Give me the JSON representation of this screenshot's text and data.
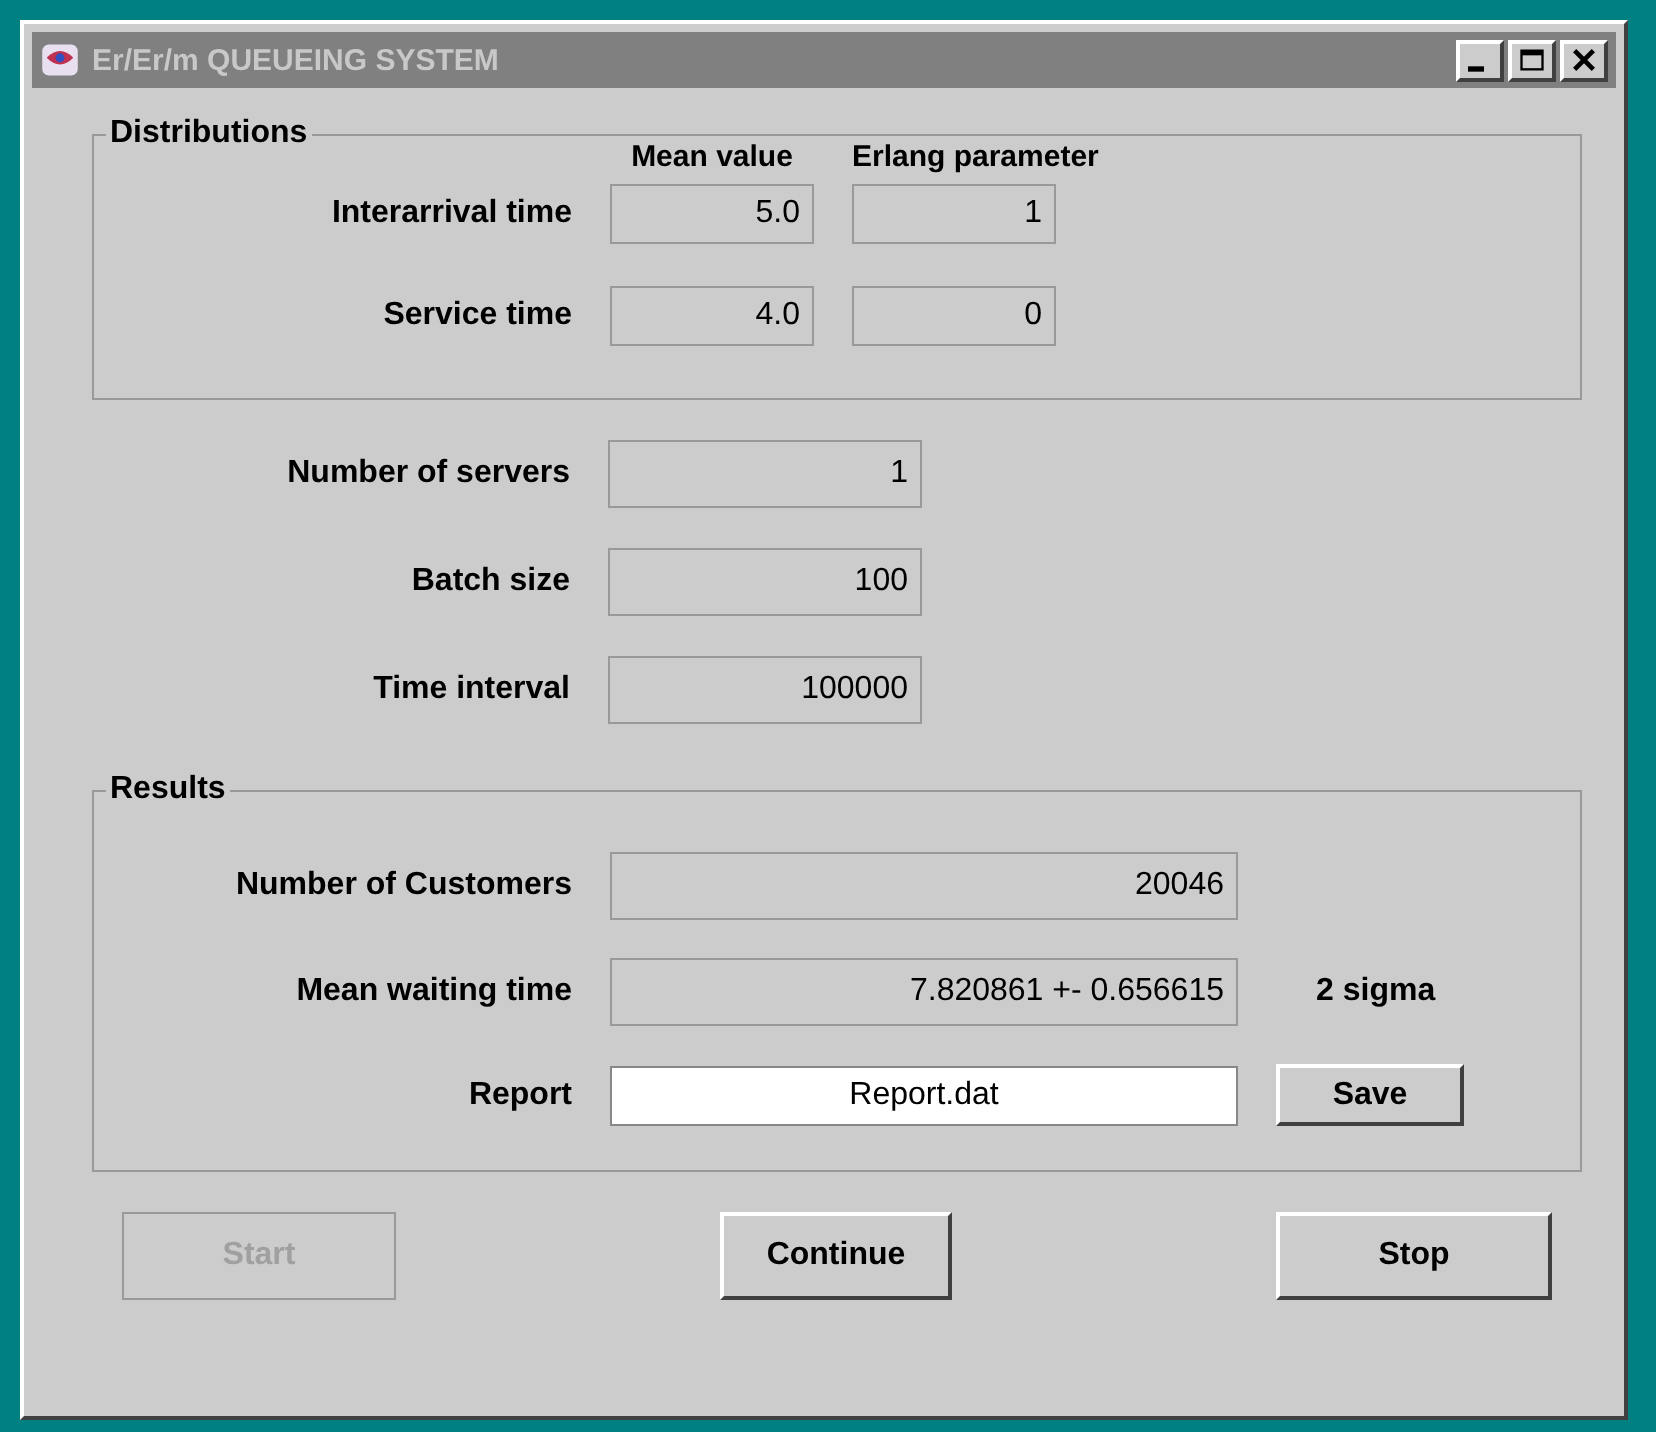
{
  "window": {
    "title": "Er/Er/m QUEUEING SYSTEM"
  },
  "distributions": {
    "legend": "Distributions",
    "columns": [
      "Mean value",
      "Erlang parameter"
    ],
    "rows": [
      {
        "label": "Interarrival time",
        "mean": "5.0",
        "erlang": "1"
      },
      {
        "label": "Service time",
        "mean": "4.0",
        "erlang": "0"
      }
    ]
  },
  "parameters": [
    {
      "label": "Number of servers",
      "value": "1"
    },
    {
      "label": "Batch size",
      "value": "100"
    },
    {
      "label": "Time interval",
      "value": "100000"
    }
  ],
  "results": {
    "legend": "Results",
    "rows": [
      {
        "kind": "output",
        "label": "Number of Customers",
        "value": "20046"
      },
      {
        "kind": "output",
        "label": "Mean waiting time",
        "value": "7.820861 +- 0.656615",
        "note": "2 sigma"
      },
      {
        "kind": "input",
        "label": "Report",
        "value": "Report.dat",
        "button": "Save"
      }
    ]
  },
  "buttons": [
    {
      "label": "Start",
      "disabled": true
    },
    {
      "label": "Continue",
      "disabled": false
    },
    {
      "label": "Stop",
      "disabled": false
    }
  ]
}
